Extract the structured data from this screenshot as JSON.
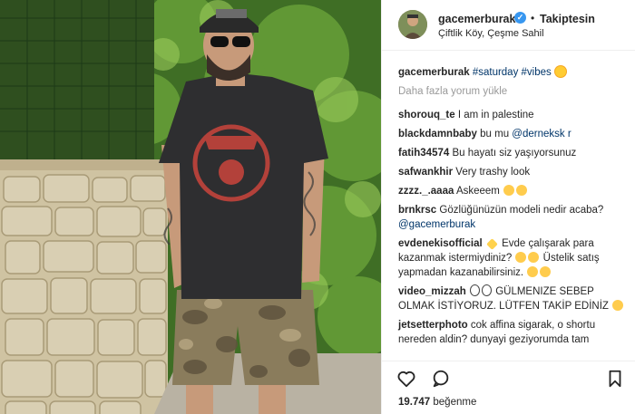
{
  "post": {
    "username": "gacemerburak",
    "verified_glyph": "✓",
    "dot": "•",
    "follow_label": "Takiptesin",
    "location": "Çiftlik Köy, Çeşme Sahil",
    "caption_user": "gacemerburak",
    "caption_tags": "#saturday #vibes",
    "load_more": "Daha fazla yorum yükle",
    "likes_count": "19.747",
    "likes_label": "beğenme"
  },
  "comments": [
    {
      "user": "shorouq_te",
      "text": "I am in palestine"
    },
    {
      "user": "blackdamnbaby",
      "text": "bu mu ",
      "tag": "@derneksk r"
    },
    {
      "user": "fatih34574",
      "text": "Bu hayatı siz yaşıyorsunuz"
    },
    {
      "user": "safwankhir",
      "text": "Very trashy look"
    },
    {
      "user": "zzzz._.aaaa",
      "text": "Askeeem"
    },
    {
      "user": "brnkrsc",
      "text": "Gözlüğünüzün modeli nedir acaba?",
      "tag": "@gacemerburak"
    },
    {
      "user": "evdenekisofficial",
      "text_a": "Evde çalışarak para kazanmak istermiydiniz?",
      "text_b": "Üstelik satış yapmadan kazanabilirsiniz."
    },
    {
      "user": "video_mizzah",
      "text": "GÜLMENIZE SEBEP OLMAK İSTİYORUZ. LÜTFEN TAKİP EDİNİZ"
    },
    {
      "user": "jetsetterphoto",
      "text": "cok affina sigarak, o shortu nereden aldin? dunyayi geziyorumda tam"
    }
  ],
  "icons": [
    "heart-icon",
    "comment-icon",
    "bookmark-icon",
    "verified-icon"
  ],
  "colors": {
    "accent_blue": "#3897f0",
    "tag_blue": "#003569",
    "muted": "#999999",
    "border": "#efefef"
  }
}
